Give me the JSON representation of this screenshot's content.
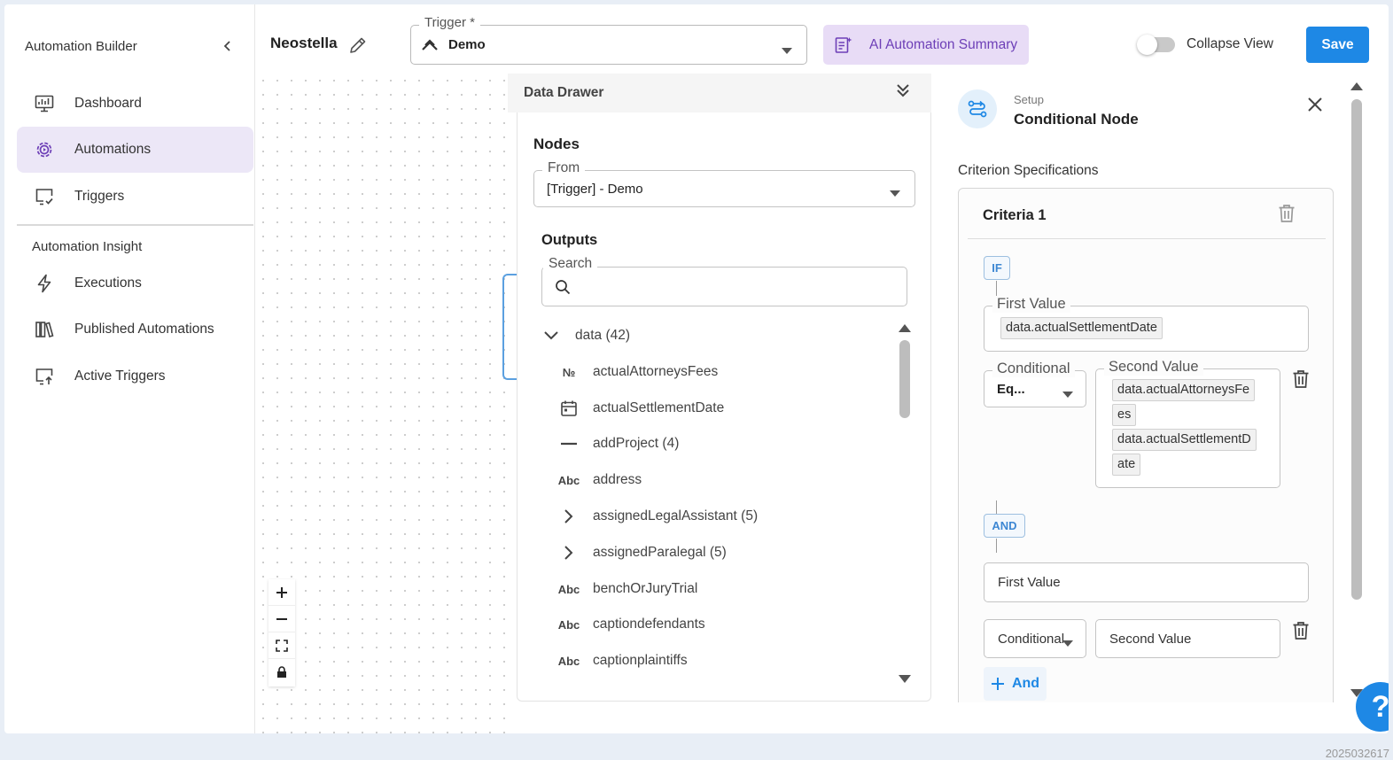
{
  "sidebar": {
    "title": "Automation Builder",
    "items": [
      {
        "label": "Dashboard",
        "icon": "monitor-chart-icon"
      },
      {
        "label": "Automations",
        "icon": "gear-cog-icon",
        "active": true
      },
      {
        "label": "Triggers",
        "icon": "screen-check-icon"
      }
    ],
    "section_label": "Automation Insight",
    "insight_items": [
      {
        "label": "Executions",
        "icon": "lightning-bolt-icon"
      },
      {
        "label": "Published Automations",
        "icon": "library-books-icon"
      },
      {
        "label": "Active Triggers",
        "icon": "screen-upload-icon"
      }
    ]
  },
  "topbar": {
    "project_name": "Neostella",
    "trigger_label": "Trigger *",
    "trigger_value": "Demo",
    "ai_summary_label": "AI Automation Summary",
    "collapse_view_label": "Collapse View",
    "save_label": "Save"
  },
  "drawer": {
    "title": "Data Drawer",
    "nodes_heading": "Nodes",
    "from_label": "From",
    "from_value": "[Trigger] - Demo",
    "outputs_heading": "Outputs",
    "search_label": "Search",
    "search_placeholder": "",
    "tree": [
      {
        "label": "data (42)",
        "icon": "chevron-down-icon"
      },
      {
        "label": "actualAttorneysFees",
        "icon": "number-sign-icon",
        "glyph": "№"
      },
      {
        "label": "actualSettlementDate",
        "icon": "calendar-icon"
      },
      {
        "label": "addProject (4)",
        "icon": "dash-icon"
      },
      {
        "label": "address",
        "icon": "text-type-icon",
        "glyph": "Abc"
      },
      {
        "label": "assignedLegalAssistant (5)",
        "icon": "chevron-right-icon"
      },
      {
        "label": "assignedParalegal (5)",
        "icon": "chevron-right-icon"
      },
      {
        "label": "benchOrJuryTrial",
        "icon": "text-type-icon",
        "glyph": "Abc"
      },
      {
        "label": "captiondefendants",
        "icon": "text-type-icon",
        "glyph": "Abc"
      },
      {
        "label": "captionplaintiffs",
        "icon": "text-type-icon",
        "glyph": "Abc"
      }
    ]
  },
  "setup": {
    "eyebrow": "Setup",
    "title": "Conditional Node",
    "criterion_heading": "Criterion Specifications",
    "criteria_title": "Criteria 1",
    "if_badge": "IF",
    "and_badge": "AND",
    "row1": {
      "first_value_label": "First Value",
      "first_value_chip": "data.actualSettlementDate",
      "conditional_label": "Conditional",
      "conditional_value": "Eq...",
      "second_value_label": "Second Value",
      "second_value_chips": [
        "data.actualAttorneysFe",
        "es",
        "data.actualSettlementD",
        "ate"
      ]
    },
    "row2": {
      "first_value_placeholder": "First Value",
      "conditional_placeholder": "Conditional",
      "second_value_placeholder": "Second Value"
    },
    "add_and_label": "And"
  },
  "footer_id": "2025032617",
  "colors": {
    "accent": "#1e88e5",
    "active_nav": "#ece7f7",
    "ai_button_bg": "#e8dcf6",
    "ai_button_text": "#6d3fb7"
  }
}
